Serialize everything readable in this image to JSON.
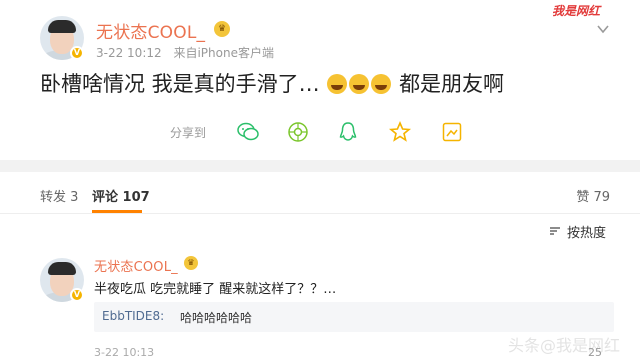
{
  "post": {
    "username": "无状态COOL_",
    "time": "3-22 10:12",
    "source": "来自iPhone客户端",
    "text_before": "卧槽啥情况 我是真的手滑了…",
    "text_after": "都是朋友啊",
    "emoji_names": [
      "laugh-cry-emoji",
      "laugh-cry-emoji",
      "laugh-cry-emoji"
    ],
    "share_label": "分享到",
    "share_targets": [
      "wechat-icon",
      "moments-icon",
      "qq-icon",
      "qzone-icon",
      "save-icon"
    ],
    "watermark": "我是网红"
  },
  "tabs": {
    "repost": "转发 3",
    "comment": "评论 107",
    "like": "赞 79"
  },
  "sort": {
    "label": "按热度"
  },
  "comment": {
    "username": "无状态COOL_",
    "text": "半夜吃瓜 吃完就睡了 醒来就这样了？？…",
    "reply_user": "EbbTIDE8:",
    "reply_text": "哈哈哈哈哈哈",
    "time": "3-22 10:13",
    "likes": "25",
    "watermark": "头条@我是网红"
  },
  "colors": {
    "username": "#eb7350",
    "tab_accent": "#ff8200",
    "reply_user": "#506b91",
    "share_icon": "#2bbf6a",
    "star_icon": "#f5b400"
  }
}
